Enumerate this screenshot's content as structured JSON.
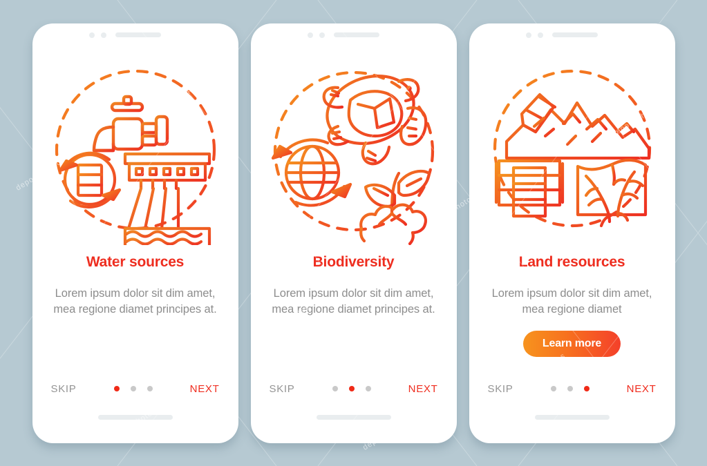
{
  "canvas": {
    "background_color": "#b6c9d2",
    "accent_red": "#ee2d1f",
    "accent_orange": "#f7931e",
    "muted_text": "#8d8d8d"
  },
  "screens": [
    {
      "id": "water-sources",
      "illustration": "faucet-dam-barrel-recycle-icon",
      "title": "Water sources",
      "body": "Lorem ipsum dolor sit dim amet, mea regione diamet principes at.",
      "cta": null,
      "skip_label": "SKIP",
      "next_label": "NEXT",
      "dots": 3,
      "active_dot": 0
    },
    {
      "id": "biodiversity",
      "illustration": "turtle-globe-sprout-icon",
      "title": "Biodiversity",
      "body": "Lorem ipsum dolor sit dim amet, mea regione diamet principes at.",
      "cta": null,
      "skip_label": "SKIP",
      "next_label": "NEXT",
      "dots": 3,
      "active_dot": 1
    },
    {
      "id": "land-resources",
      "illustration": "mountains-barrels-field-icon",
      "title": "Land resources",
      "body": "Lorem ipsum dolor sit dim amet, mea regione diamet",
      "cta": "Learn more",
      "skip_label": "SKIP",
      "next_label": "NEXT",
      "dots": 3,
      "active_dot": 2
    }
  ],
  "watermark": {
    "text": "depositphotos"
  }
}
